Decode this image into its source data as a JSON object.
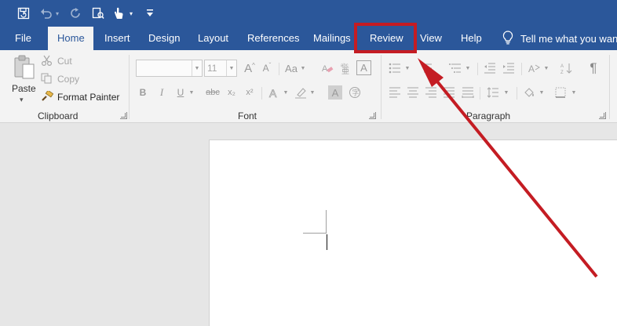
{
  "qat": {
    "icons": [
      "save-icon",
      "undo-icon",
      "redo-icon",
      "touch-mode-icon",
      "customize-icon"
    ]
  },
  "tabs": [
    {
      "label": "File"
    },
    {
      "label": "Home"
    },
    {
      "label": "Insert"
    },
    {
      "label": "Design"
    },
    {
      "label": "Layout"
    },
    {
      "label": "References"
    },
    {
      "label": "Mailings"
    },
    {
      "label": "Review"
    },
    {
      "label": "View"
    },
    {
      "label": "Help"
    }
  ],
  "tell_me": "Tell me what you want",
  "clipboard": {
    "paste": "Paste",
    "cut": "Cut",
    "copy": "Copy",
    "format_painter": "Format Painter",
    "group_label": "Clipboard"
  },
  "font": {
    "font_name": "",
    "font_size": "11",
    "bold": "B",
    "italic": "I",
    "underline": "U",
    "strikethrough": "abc",
    "subscript": "x₂",
    "superscript": "x²",
    "change_case": "Aa",
    "group_label": "Font"
  },
  "paragraph": {
    "pilcrow": "¶",
    "group_label": "Paragraph"
  },
  "colors": {
    "brand": "#2b579a",
    "annotation": "#c41c23",
    "ribbon": "#f3f3f3"
  }
}
